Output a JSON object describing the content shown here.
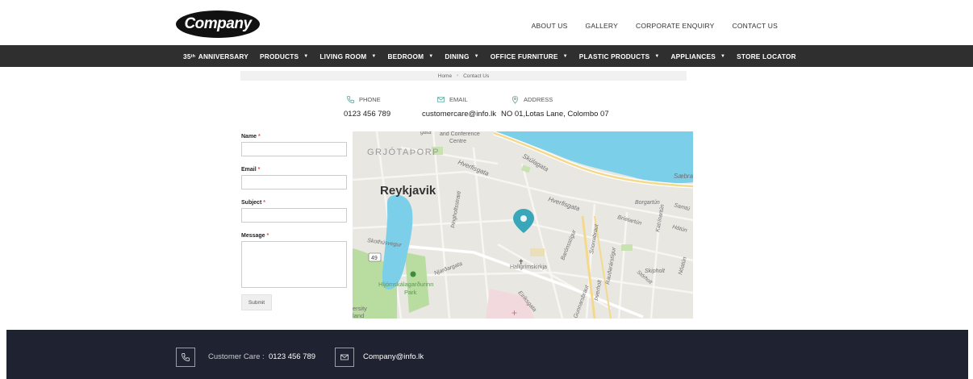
{
  "brand": {
    "logo_text": "Company",
    "logo_bg": "#111111"
  },
  "top_nav": {
    "items": [
      "ABOUT US",
      "GALLERY",
      "CORPORATE ENQUIRY",
      "CONTACT US"
    ]
  },
  "main_nav": {
    "anniversary_number": "35",
    "anniversary_suffix": "th",
    "anniversary_label": "ANNIVERSARY",
    "items": [
      {
        "label": "PRODUCTS",
        "has_dropdown": true
      },
      {
        "label": "LIVING ROOM",
        "has_dropdown": true
      },
      {
        "label": "BEDROOM",
        "has_dropdown": true
      },
      {
        "label": "DINING",
        "has_dropdown": true
      },
      {
        "label": "OFFICE FURNITURE",
        "has_dropdown": true
      },
      {
        "label": "PLASTIC PRODUCTS",
        "has_dropdown": true
      },
      {
        "label": "APPLIANCES",
        "has_dropdown": true
      },
      {
        "label": "STORE LOCATOR",
        "has_dropdown": false
      }
    ],
    "caret": "▼",
    "bg": "#2f2f2f"
  },
  "breadcrumb": {
    "home": "Home",
    "separator": "›",
    "current": "Contact Us"
  },
  "contact_info": {
    "phone_label": "PHONE",
    "phone_value": "0123 456 789",
    "email_label": "EMAIL",
    "email_value": "customercare@info.lk",
    "address_label": "ADDRESS",
    "address_value": "NO 01,Lotas Lane, Colombo 07",
    "icon_color": "#5fa8a0"
  },
  "form": {
    "name_label": "Name",
    "email_label": "Email",
    "subject_label": "Subject",
    "message_label": "Message",
    "required_mark": "*",
    "submit_label": "Submit"
  },
  "map": {
    "labels": {
      "conference": "and Conference",
      "centre": "Centre",
      "grjota": "GRJÓTAÞORP",
      "reykjavik": "Reykjavik",
      "hverfisgata1": "Hverfisgata",
      "skulagata": "Skúlagata",
      "saebra": "Sæbra",
      "hverfisgata2": "Hverfisgata",
      "borgartun": "Borgartún",
      "samtu": "Samtú",
      "brietartun": "Bríetartún",
      "hatun": "Hátún",
      "katrinartun": "Katrínartún",
      "skothusvegur": "Skothúsvegur",
      "road49": "49",
      "njardargata": "Njarðargata",
      "hallgrimskirkja": "Hallgrímskirkja",
      "baronsstigur": "Barónsstígur",
      "snorrabraut": "Snorrabraut",
      "raudararstigur": "Rauðarárstígur",
      "thverholt": "Þverholt",
      "skipholt": "Skipholt",
      "nlatun": "Nóatún",
      "stortholt": "Stórholt",
      "hljomskala": "Hljómskálagarðurinn",
      "park": "Park",
      "eiriksgata": "Eiríksgata",
      "gunnarsbraut": "Gunnarsbraut",
      "thingholtsstraeti": "Þingholtsstræti",
      "ersity": "ersity",
      "land": "land",
      "gata_top": "gata"
    },
    "water_color": "#7ccfe8",
    "park_color": "#b9dca0",
    "pin_color": "#3aa6b9"
  },
  "footer": {
    "customer_care_label": "Customer Care :",
    "customer_care_value": "0123 456 789",
    "email_value": "Company@info.lk",
    "bg": "#1f2230"
  }
}
